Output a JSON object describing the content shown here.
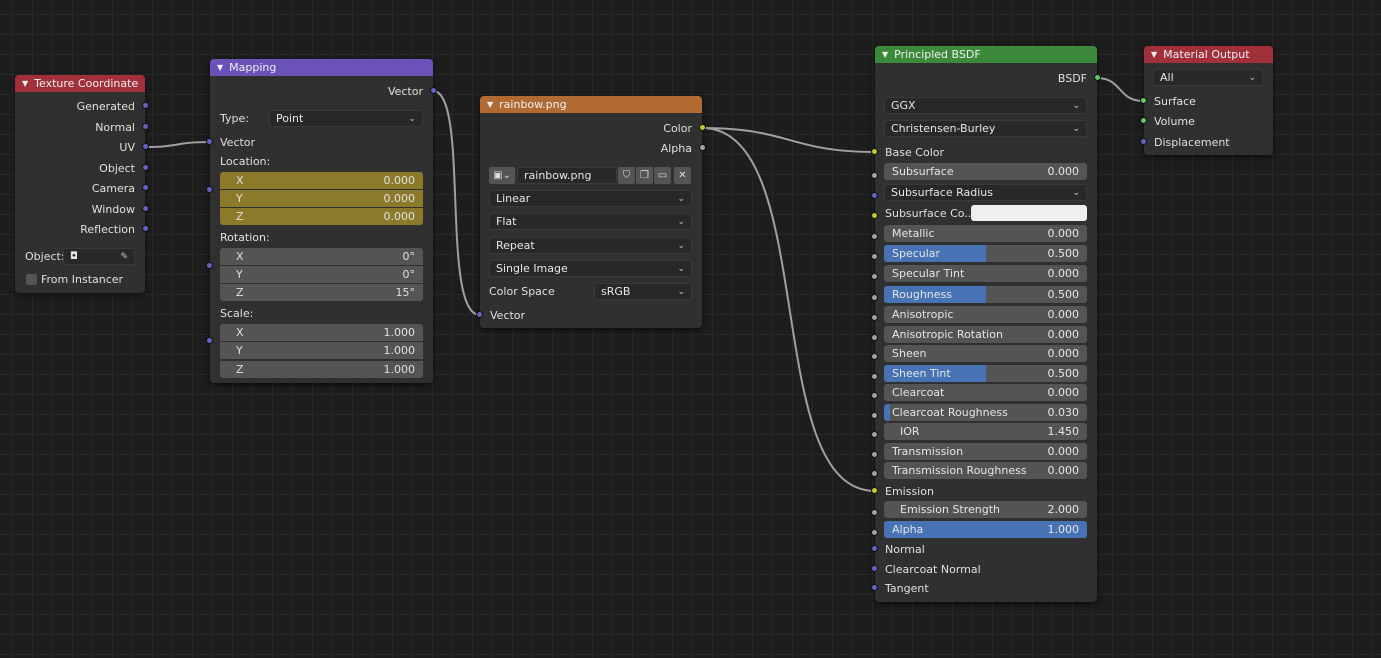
{
  "texcoord": {
    "title": "Texture Coordinate",
    "outputs": [
      "Generated",
      "Normal",
      "UV",
      "Object",
      "Camera",
      "Window",
      "Reflection"
    ],
    "object_label": "Object:",
    "from_instancer_label": "From Instancer",
    "header_color": "#a1303a"
  },
  "mapping": {
    "title": "Mapping",
    "output": "Vector",
    "type_label": "Type:",
    "type_value": "Point",
    "input_vector": "Vector",
    "location_label": "Location:",
    "rotation_label": "Rotation:",
    "scale_label": "Scale:",
    "location": [
      {
        "axis": "X",
        "value": "0.000"
      },
      {
        "axis": "Y",
        "value": "0.000"
      },
      {
        "axis": "Z",
        "value": "0.000"
      }
    ],
    "rotation": [
      {
        "axis": "X",
        "value": "0°"
      },
      {
        "axis": "Y",
        "value": "0°"
      },
      {
        "axis": "Z",
        "value": "15°"
      }
    ],
    "scale": [
      {
        "axis": "X",
        "value": "1.000"
      },
      {
        "axis": "Y",
        "value": "1.000"
      },
      {
        "axis": "Z",
        "value": "1.000"
      }
    ],
    "header_color": "#6a52b8",
    "location_color": "#8a7a2a"
  },
  "image": {
    "title": "rainbow.png",
    "outputs": [
      "Color",
      "Alpha"
    ],
    "filename": "rainbow.png",
    "interpolation": "Linear",
    "projection": "Flat",
    "extension": "Repeat",
    "source": "Single Image",
    "colorspace_label": "Color Space",
    "colorspace_value": "sRGB",
    "input_vector": "Vector",
    "header_color": "#b06a32"
  },
  "bsdf": {
    "title": "Principled BSDF",
    "output": "BSDF",
    "distribution": "GGX",
    "subsurface_method": "Christensen-Burley",
    "base_color_label": "Base Color",
    "subsurface": {
      "label": "Subsurface",
      "value": "0.000"
    },
    "subsurface_radius": "Subsurface Radius",
    "subsurface_color_label": "Subsurface Co...",
    "metallic": {
      "label": "Metallic",
      "value": "0.000"
    },
    "specular": {
      "label": "Specular",
      "value": "0.500",
      "fraction": 0.5
    },
    "specular_tint": {
      "label": "Specular Tint",
      "value": "0.000"
    },
    "roughness": {
      "label": "Roughness",
      "value": "0.500",
      "fraction": 0.5
    },
    "anisotropic": {
      "label": "Anisotropic",
      "value": "0.000"
    },
    "anisotropic_rotation": {
      "label": "Anisotropic Rotation",
      "value": "0.000"
    },
    "sheen": {
      "label": "Sheen",
      "value": "0.000"
    },
    "sheen_tint": {
      "label": "Sheen Tint",
      "value": "0.500",
      "fraction": 0.5
    },
    "clearcoat": {
      "label": "Clearcoat",
      "value": "0.000"
    },
    "clearcoat_roughness": {
      "label": "Clearcoat Roughness",
      "value": "0.030",
      "fraction": 0.03
    },
    "ior": {
      "label": "IOR",
      "value": "1.450"
    },
    "transmission": {
      "label": "Transmission",
      "value": "0.000"
    },
    "transmission_roughness": {
      "label": "Transmission Roughness",
      "value": "0.000"
    },
    "emission_label": "Emission",
    "emission_strength": {
      "label": "Emission Strength",
      "value": "2.000"
    },
    "alpha": {
      "label": "Alpha",
      "value": "1.000",
      "fraction": 1.0
    },
    "normal_label": "Normal",
    "clearcoat_normal_label": "Clearcoat Normal",
    "tangent_label": "Tangent",
    "header_color": "#3b8a3b",
    "slider_color": "#4772b3"
  },
  "output_node": {
    "title": "Material Output",
    "target": "All",
    "inputs": [
      "Surface",
      "Volume",
      "Displacement"
    ],
    "header_color": "#a1303a"
  }
}
